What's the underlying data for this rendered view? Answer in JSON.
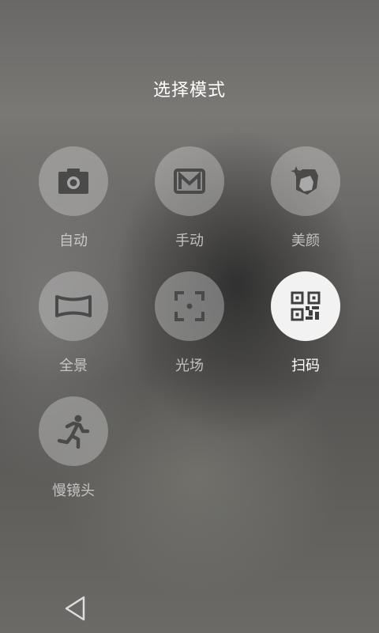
{
  "title": "选择模式",
  "modes": [
    {
      "label": "自动",
      "icon": "camera-icon"
    },
    {
      "label": "手动",
      "icon": "manual-m-icon"
    },
    {
      "label": "美颜",
      "icon": "beauty-icon"
    },
    {
      "label": "全景",
      "icon": "panorama-icon"
    },
    {
      "label": "光场",
      "icon": "focus-frame-icon"
    },
    {
      "label": "扫码",
      "icon": "qr-code-icon",
      "selected": true
    },
    {
      "label": "慢镜头",
      "icon": "running-man-icon"
    }
  ],
  "nav": {
    "back_icon": "back-triangle-icon"
  }
}
